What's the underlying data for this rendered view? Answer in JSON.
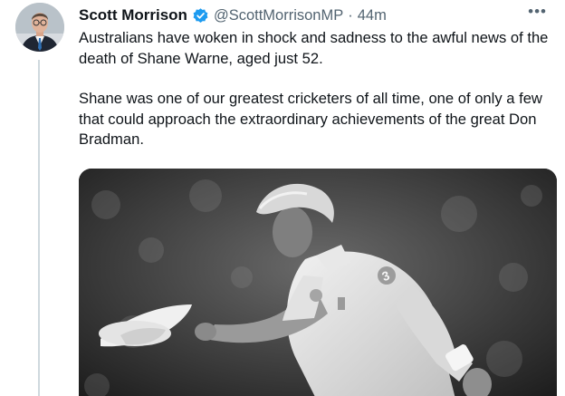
{
  "tweet": {
    "author": {
      "display_name": "Scott Morrison",
      "handle": "@ScottMorrisonMP",
      "verified": true,
      "avatar": "avatar-photo"
    },
    "separator": "·",
    "timestamp": "44m",
    "more_icon": "•••",
    "text": {
      "paragraph_1": "Australians have woken in shock and sadness to the awful news of the death of Shane Warne, aged just 52.",
      "paragraph_2": "Shane was one of our greatest cricketers of all time, one of only a few that could approach the extraordinary achievements of the great Don Bradman."
    },
    "media": {
      "kind": "photo",
      "style": "black-and-white"
    },
    "colors": {
      "verified": "#1d9bf0",
      "secondary_text": "#536471",
      "primary_text": "#0f1419",
      "thread_line": "#cfd9de"
    }
  }
}
